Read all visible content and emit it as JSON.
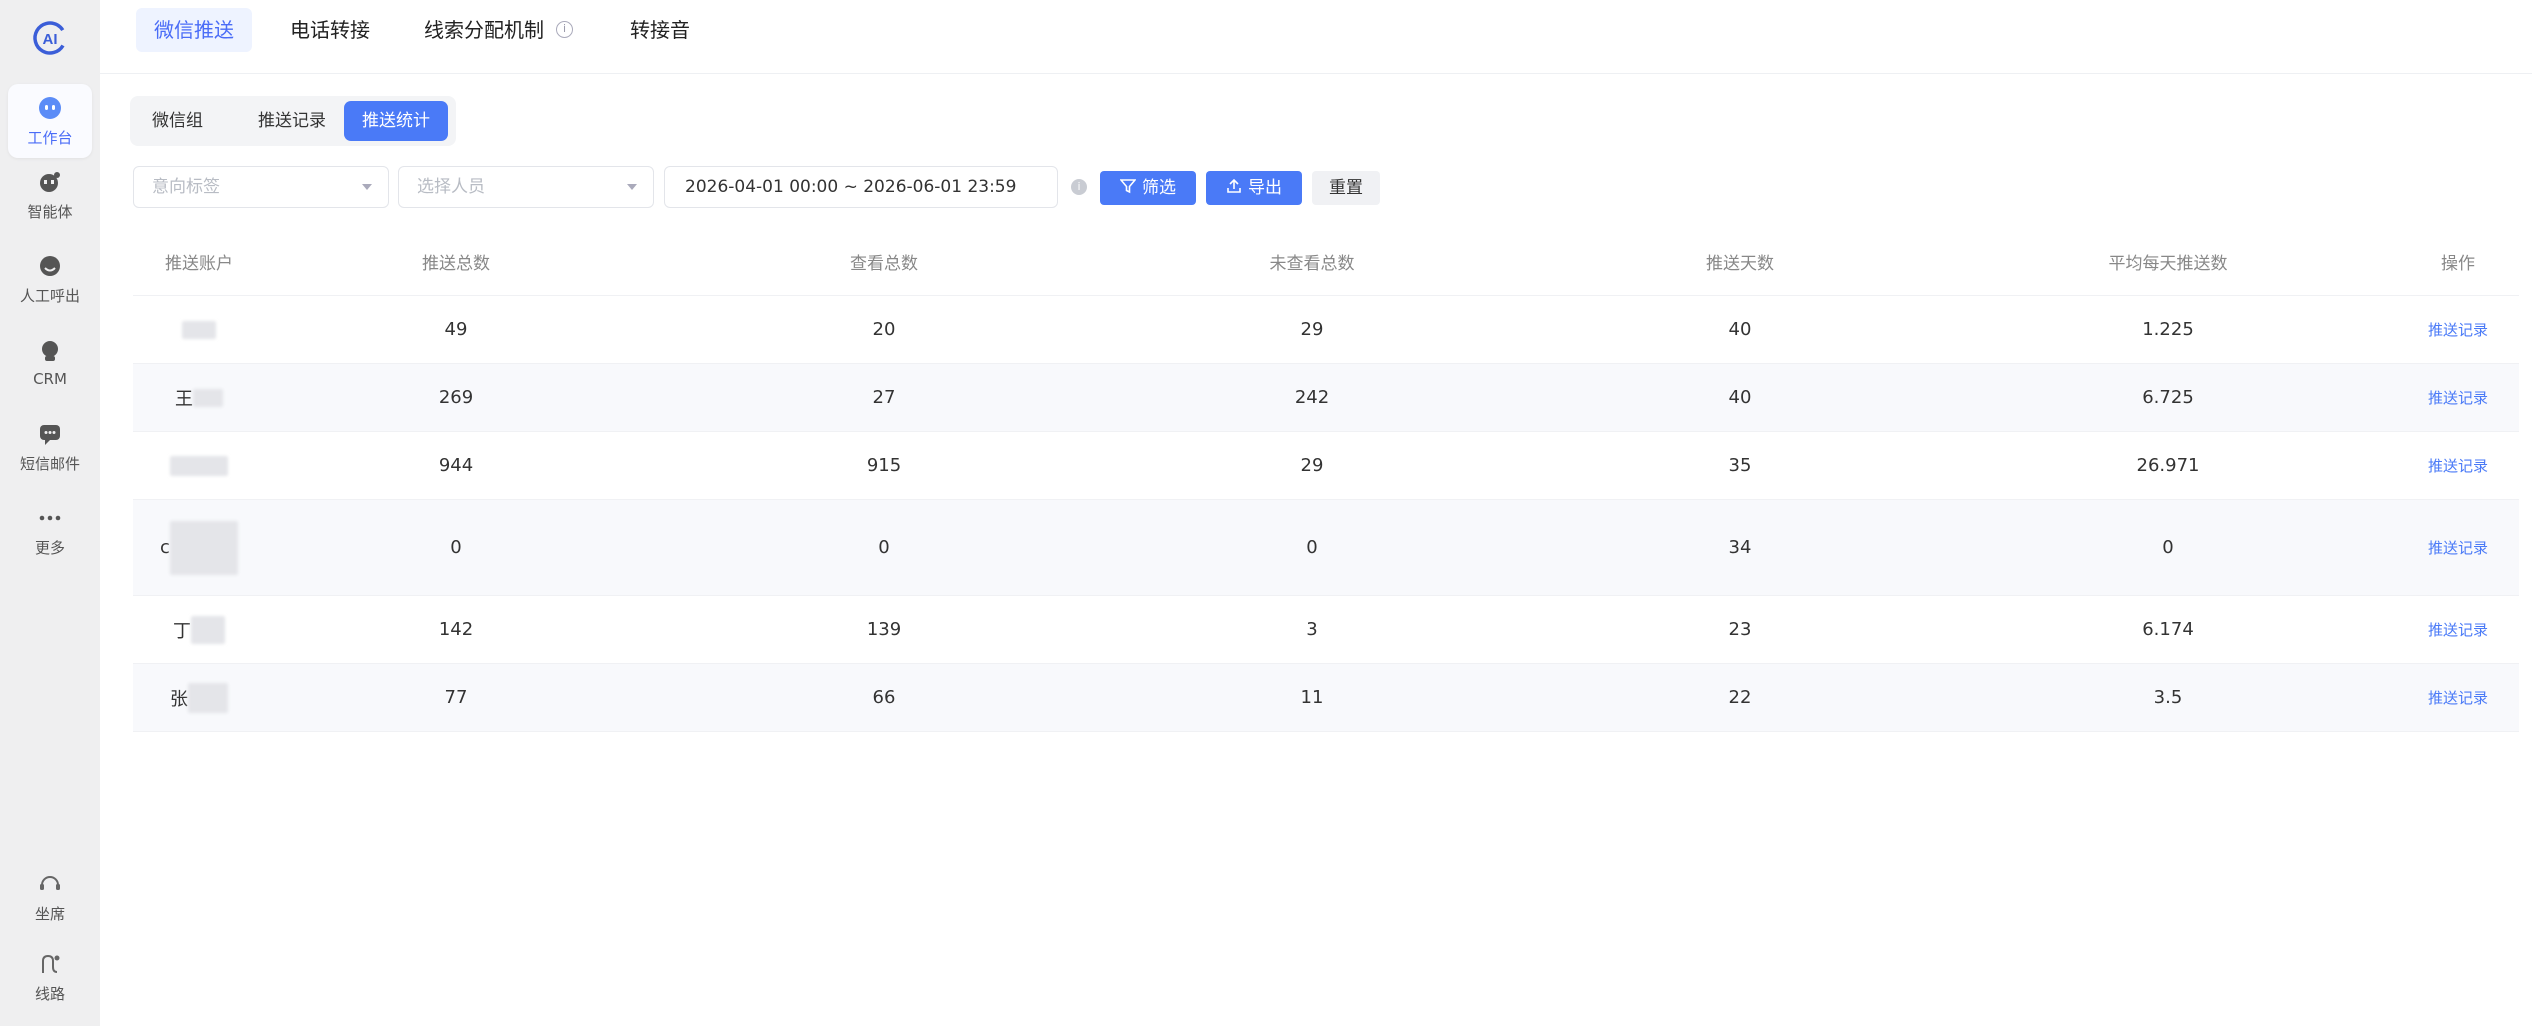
{
  "sidebar": {
    "items": [
      {
        "label": "工作台",
        "icon": "robot-icon",
        "active": true
      },
      {
        "label": "智能体",
        "icon": "agent-icon",
        "active": false
      },
      {
        "label": "人工呼出",
        "icon": "headset-icon",
        "active": false
      },
      {
        "label": "CRM",
        "icon": "crm-icon",
        "active": false
      },
      {
        "label": "短信邮件",
        "icon": "message-icon",
        "active": false
      },
      {
        "label": "更多",
        "icon": "more-icon",
        "active": false
      }
    ],
    "bottom": [
      {
        "label": "坐席",
        "icon": "seat-icon"
      },
      {
        "label": "线路",
        "icon": "route-icon"
      }
    ]
  },
  "top_tabs": [
    {
      "label": "微信推送",
      "active": true
    },
    {
      "label": "电话转接",
      "active": false
    },
    {
      "label": "线索分配机制",
      "active": false
    },
    {
      "label": "转接音",
      "active": false
    }
  ],
  "sub_tabs": [
    {
      "label": "微信组",
      "active": false
    },
    {
      "label": "推送记录",
      "active": false
    },
    {
      "label": "推送统计",
      "active": true
    }
  ],
  "filters": {
    "intent_placeholder": "意向标签",
    "person_placeholder": "选择人员",
    "date_range": "2026-04-01 00:00 ~ 2026-06-01 23:59",
    "filter_label": "筛选",
    "export_label": "导出",
    "reset_label": "重置"
  },
  "table": {
    "headers": [
      "推送账户",
      "推送总数",
      "查看总数",
      "未查看总数",
      "推送天数",
      "平均每天推送数",
      "操作"
    ],
    "rows": [
      {
        "account": "",
        "total": "49",
        "viewed": "20",
        "unviewed": "29",
        "days": "40",
        "avg": "1.225",
        "action": "推送记录"
      },
      {
        "account": "王",
        "total": "269",
        "viewed": "27",
        "unviewed": "242",
        "days": "40",
        "avg": "6.725",
        "action": "推送记录"
      },
      {
        "account": "",
        "total": "944",
        "viewed": "915",
        "unviewed": "29",
        "days": "35",
        "avg": "26.971",
        "action": "推送记录"
      },
      {
        "account": "c",
        "total": "0",
        "viewed": "0",
        "unviewed": "0",
        "days": "34",
        "avg": "0",
        "action": "推送记录"
      },
      {
        "account": "丁",
        "total": "142",
        "viewed": "139",
        "unviewed": "3",
        "days": "23",
        "avg": "6.174",
        "action": "推送记录"
      },
      {
        "account": "张",
        "total": "77",
        "viewed": "66",
        "unviewed": "11",
        "days": "22",
        "avg": "3.5",
        "action": "推送记录"
      }
    ]
  },
  "colors": {
    "accent": "#4a7af7",
    "sidebar_bg": "#efeff0"
  }
}
